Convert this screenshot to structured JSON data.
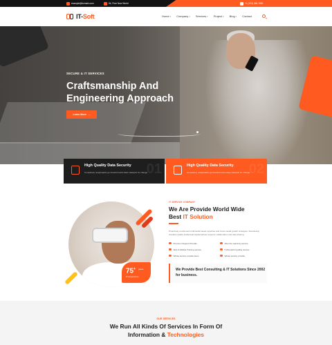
{
  "topbar": {
    "email": "example@domain.com",
    "address": "54, Pure New World",
    "phone": "+1 (123) 456-7890"
  },
  "brand": {
    "name_part1": "IT-",
    "name_part2": "Soft"
  },
  "nav": {
    "items": [
      "Home",
      "Company",
      "Services",
      "Project",
      "Blog",
      "Contact"
    ]
  },
  "hero": {
    "subtitle": "SECURE & IT SERVICES",
    "title_line1": "Craftsmanship And",
    "title_line2": "Engineering Approach",
    "button_label": "Learn More"
  },
  "features": [
    {
      "title": "High Quality Data Security",
      "text": "Completely recaptiualize go forward world-class catalysts for change",
      "num": "01"
    },
    {
      "title": "High Quality Data Security",
      "text": "Completely recaptiualize go forward world-class catalysts for change",
      "num": "02"
    }
  ],
  "about": {
    "subtitle": "IT SERVICE COMPANY",
    "title_line1": "We Are Provide World Wide",
    "title_prefix": "Best ",
    "title_accent": "IT Solution",
    "description": "Proactively envisioned multimedia based expertise and cross-media growth strategies. Seamlessly visualize quality intellectual capital without superior collaboration and idea-sharing.",
    "checks": [
      "Premium Support Provide",
      "After the warranty service",
      "Web & Mobile Training service",
      "5 Wonderful quality service",
      "Whole service provide team",
      "Whole service provide"
    ],
    "box_text": "We Provide Best Consulting & IT Solutions Since 2002 for business.",
    "experience_num": "75",
    "experience_sup": "+",
    "experience_label": "IT Experience",
    "experience_side": "years"
  },
  "services": {
    "subtitle": "OUR SERVICES",
    "title_line1": "We Run All Kinds Of Services In Form Of",
    "title_prefix": "Information & ",
    "title_accent": "Technologies"
  },
  "colors": {
    "accent": "#ff5a1f",
    "dark": "#1e1e1e"
  }
}
